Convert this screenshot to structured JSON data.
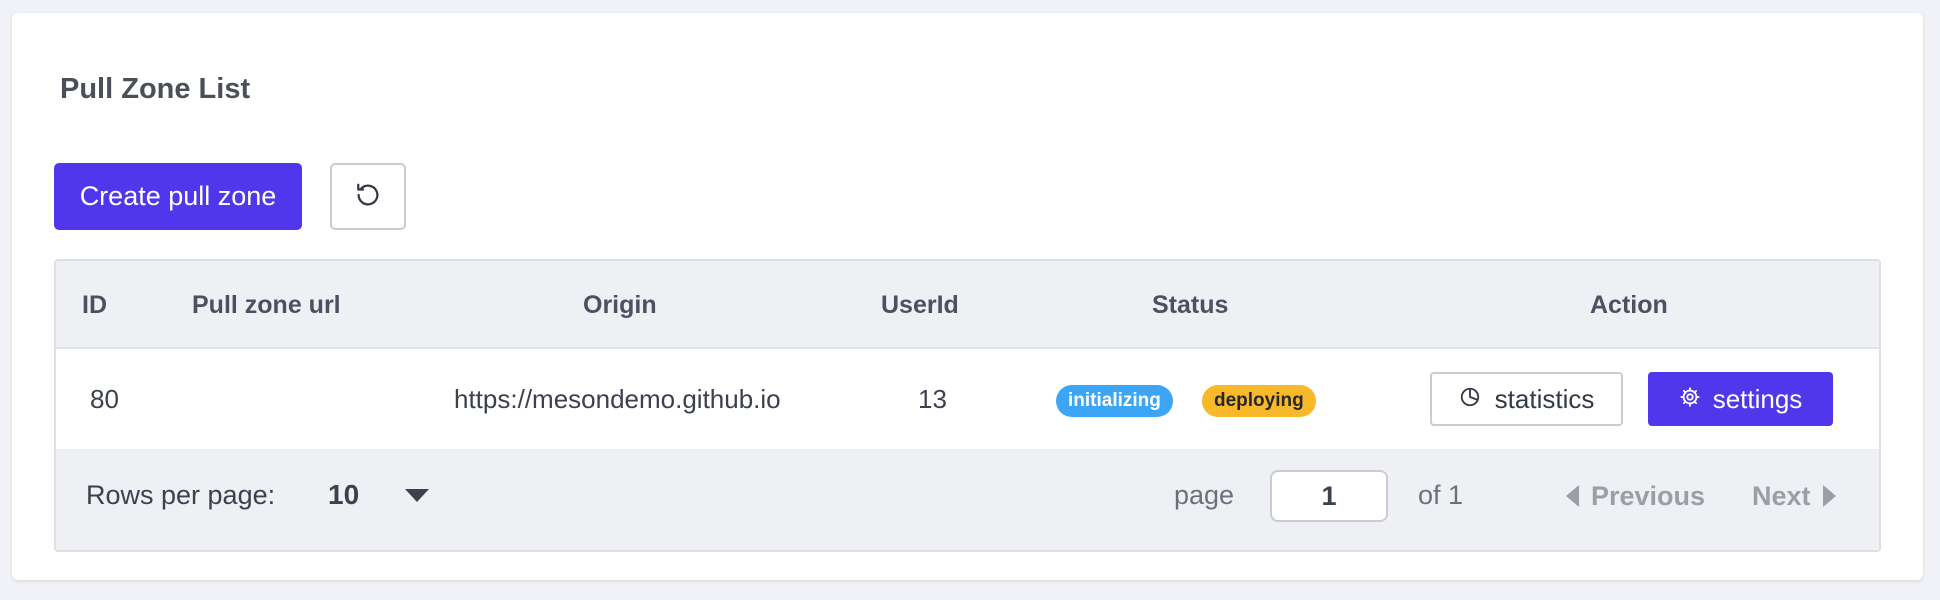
{
  "page": {
    "title": "Pull Zone List"
  },
  "toolbar": {
    "create_label": "Create pull zone",
    "refresh_icon": "refresh-icon"
  },
  "table": {
    "columns": [
      "ID",
      "Pull zone url",
      "Origin",
      "UserId",
      "Status",
      "Action"
    ],
    "rows": [
      {
        "id": "80",
        "pull_zone_url": "",
        "origin": "https://mesondemo.github.io",
        "user_id": "13",
        "status_badges": [
          "initializing",
          "deploying"
        ],
        "actions": {
          "statistics_label": "statistics",
          "statistics_icon": "pie-chart-icon",
          "settings_label": "settings",
          "settings_icon": "gear-icon"
        }
      }
    ]
  },
  "pagination": {
    "rows_per_page_label": "Rows per page:",
    "rows_per_page_value": "10",
    "page_label": "page",
    "current_page": "1",
    "of_label": "of 1",
    "previous_label": "Previous",
    "next_label": "Next"
  },
  "colors": {
    "primary": "#5037ec",
    "badge_initializing": "#3da5f5",
    "badge_deploying": "#f7b82a"
  }
}
